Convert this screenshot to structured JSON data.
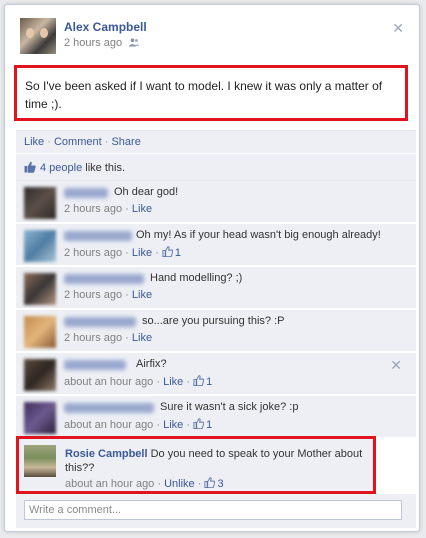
{
  "post": {
    "author": "Alex Campbell",
    "time": "2 hours ago",
    "text": "So I've been asked if I want to model. I knew it was only a matter of time ;)."
  },
  "actions": {
    "like": "Like",
    "comment": "Comment",
    "share": "Share",
    "separator": "·"
  },
  "likes": {
    "count_label": "4 people",
    "suffix": "like this."
  },
  "comments": [
    {
      "text": "Oh dear god!",
      "time": "2 hours ago",
      "like_action": "Like",
      "likes": ""
    },
    {
      "text": "Oh my! As if your head wasn't big enough already!",
      "time": "2 hours ago",
      "like_action": "Like",
      "likes": "1"
    },
    {
      "text": "Hand modelling? ;)",
      "time": "2 hours ago",
      "like_action": "Like",
      "likes": ""
    },
    {
      "text": "so...are you pursuing this? :P",
      "time": "2 hours ago",
      "like_action": "Like",
      "likes": ""
    },
    {
      "text": "Airfix?",
      "time": "about an hour ago",
      "like_action": "Like",
      "likes": "1"
    },
    {
      "text": "Sure it wasn't a sick joke? :p",
      "time": "about an hour ago",
      "like_action": "Like",
      "likes": "1"
    }
  ],
  "rosie": {
    "name": "Rosie Campbell",
    "text": "Do you need to speak to your Mother about this??",
    "time": "about an hour ago",
    "like_action": "Unlike",
    "likes": "3"
  },
  "composer": {
    "placeholder": "Write a comment..."
  },
  "icons": {
    "close": "close-icon",
    "friends": "friends-icon",
    "thumbs_up": "thumbs-up-icon"
  },
  "colors": {
    "link": "#3b5998",
    "highlight_border": "#e0141e",
    "panel_bg": "#edeff4"
  }
}
